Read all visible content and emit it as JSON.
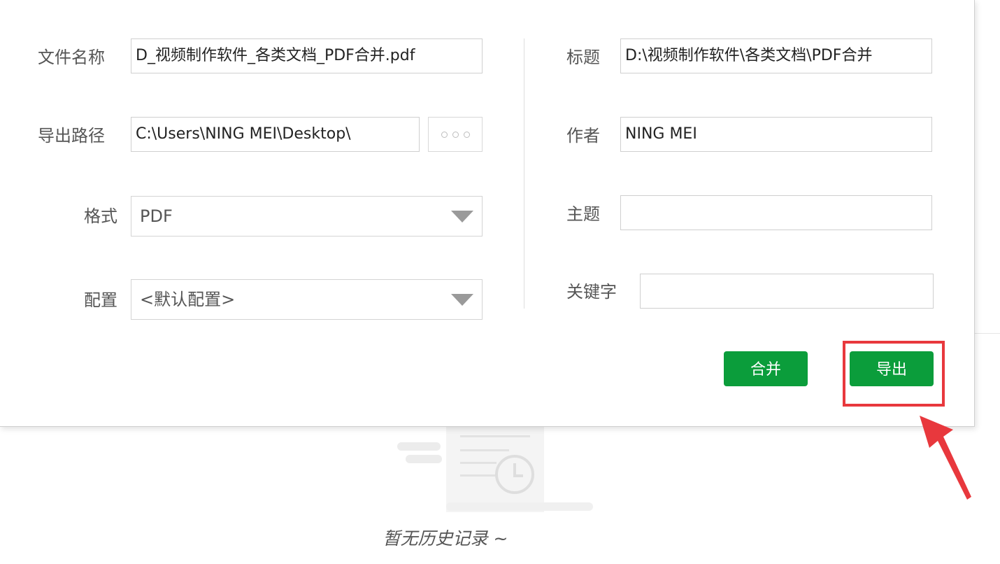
{
  "dialog": {
    "left": {
      "filename": {
        "label": "文件名称",
        "value": "D_视频制作软件_各类文档_PDF合并.pdf"
      },
      "export_path": {
        "label": "导出路径",
        "value": "C:\\Users\\NING MEI\\Desktop\\",
        "browse_icon": "ellipsis-icon"
      },
      "format": {
        "label": "格式",
        "selected": "PDF"
      },
      "config": {
        "label": "配置",
        "selected": "<默认配置>"
      }
    },
    "right": {
      "title": {
        "label": "标题",
        "value": "D:\\视频制作软件\\各类文档\\PDF合并"
      },
      "author": {
        "label": "作者",
        "value": "NING MEI"
      },
      "subject": {
        "label": "主题",
        "value": ""
      },
      "keywords": {
        "label": "关键字",
        "value": ""
      }
    },
    "buttons": {
      "merge": "合并",
      "export": "导出"
    }
  },
  "history": {
    "empty_text": "暂无历史记录 ~",
    "illustration_icon": "document-clock-icon"
  },
  "annotation": {
    "highlight_color": "#e8383d",
    "target": "export-button"
  },
  "colors": {
    "accent": "#0b9d3b",
    "annotation": "#e8383d"
  }
}
